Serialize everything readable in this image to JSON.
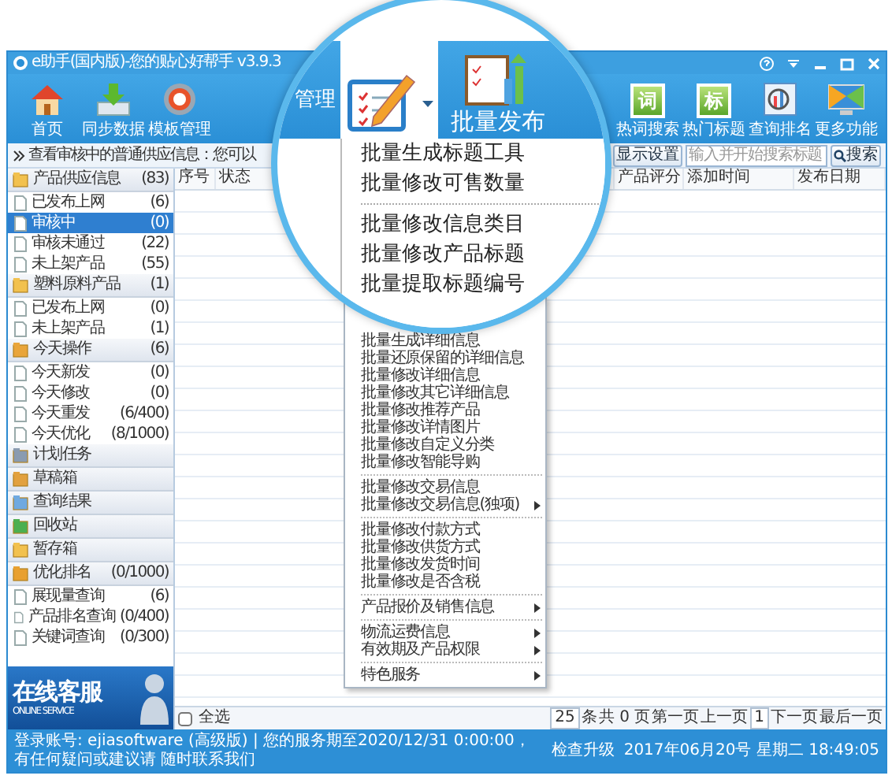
{
  "window": {
    "title": "e助手(国内版)-您的贴心好帮手 v3.9.3"
  },
  "toolbar": {
    "left": [
      {
        "kind": "home",
        "label": "首页"
      },
      {
        "kind": "sync",
        "label": "同步数据"
      },
      {
        "kind": "template",
        "label": "模板管理"
      }
    ],
    "right": [
      {
        "kind": "tile",
        "icon_text": "词",
        "label": "热词搜索"
      },
      {
        "kind": "tile",
        "icon_text": "标",
        "label": "热门标题"
      },
      {
        "kind": "rank",
        "label": "查询排名"
      },
      {
        "kind": "monitor",
        "label": "更多功能"
      }
    ]
  },
  "info_bar": {
    "text": "查看审核中的普通供应信息：您可以",
    "settings_button": "显示设置",
    "search": {
      "placeholder": "输入并开始搜索标题"
    },
    "search_button": "搜索"
  },
  "sidebar": {
    "groups": [
      {
        "kind": "folder",
        "label": "产品供应信息",
        "count": "(83)",
        "items": [
          {
            "label": "已发布上网",
            "count": "(6)",
            "selected": false
          },
          {
            "label": "审核中",
            "count": "(0)",
            "selected": true
          },
          {
            "label": "审核未通过",
            "count": "(22)",
            "selected": false
          },
          {
            "label": "未上架产品",
            "count": "(55)",
            "selected": false
          }
        ]
      },
      {
        "kind": "folder",
        "label": "塑料原料产品",
        "count": "(1)",
        "items": [
          {
            "label": "已发布上网",
            "count": "(0)",
            "selected": false
          },
          {
            "label": "未上架产品",
            "count": "(1)",
            "selected": false
          }
        ]
      },
      {
        "kind": "today",
        "label": "今天操作",
        "count": "(6)",
        "items": [
          {
            "label": "今天新发",
            "count": "(0)",
            "selected": false
          },
          {
            "label": "今天修改",
            "count": "(0)",
            "selected": false
          },
          {
            "label": "今天重发",
            "count": "(6/400)",
            "selected": false
          },
          {
            "label": "今天优化",
            "count": "(8/1000)",
            "selected": false
          }
        ]
      },
      {
        "kind": "tasks",
        "label": "计划任务"
      },
      {
        "kind": "draft",
        "label": "草稿箱"
      },
      {
        "kind": "results",
        "label": "查询结果"
      },
      {
        "kind": "recycle",
        "label": "回收站"
      },
      {
        "kind": "folder",
        "label": "暂存箱"
      },
      {
        "kind": "ranking",
        "label": "优化排名",
        "count": "(0/1000)",
        "items": [
          {
            "label": "展现量查询",
            "count": "(6)",
            "selected": false
          },
          {
            "label": "产品排名查询",
            "count": "(0/400)",
            "selected": false
          },
          {
            "label": "关键词查询",
            "count": "(0/300)",
            "selected": false
          }
        ]
      }
    ],
    "banner": {
      "title": "在线客服",
      "subtitle": "ONLINE SERVICE"
    }
  },
  "table": {
    "columns": [
      "序号",
      "状态",
      "产品评分",
      "添加时间",
      "发布日期"
    ]
  },
  "pager": {
    "select_all": "全选",
    "checked": false,
    "page_size": "25",
    "unit": "条",
    "total": "共 0 页",
    "first": "第一页",
    "prev": "上一页",
    "page": "1",
    "next": "下一页",
    "last": "最后一页"
  },
  "menu": [
    {
      "kind": "item",
      "label": "批量生成详细信息",
      "submenu": false
    },
    {
      "kind": "item",
      "label": "批量还原保留的详细信息",
      "submenu": false
    },
    {
      "kind": "item",
      "label": "批量修改详细信息",
      "submenu": false
    },
    {
      "kind": "item",
      "label": "批量修改其它详细信息",
      "submenu": false
    },
    {
      "kind": "item",
      "label": "批量修改推荐产品",
      "submenu": false
    },
    {
      "kind": "item",
      "label": "批量修改详情图片",
      "submenu": false
    },
    {
      "kind": "item",
      "label": "批量修改自定义分类",
      "submenu": false
    },
    {
      "kind": "item",
      "label": "批量修改智能导购",
      "submenu": false
    },
    {
      "kind": "separator"
    },
    {
      "kind": "item",
      "label": "批量修改交易信息",
      "submenu": false
    },
    {
      "kind": "item",
      "label": "批量修改交易信息(独项)",
      "submenu": true
    },
    {
      "kind": "separator"
    },
    {
      "kind": "item",
      "label": "批量修改付款方式",
      "submenu": false
    },
    {
      "kind": "item",
      "label": "批量修改供货方式",
      "submenu": false
    },
    {
      "kind": "item",
      "label": "批量修改发货时间",
      "submenu": false
    },
    {
      "kind": "item",
      "label": "批量修改是否含税",
      "submenu": false
    },
    {
      "kind": "separator"
    },
    {
      "kind": "item",
      "label": "产品报价及销售信息",
      "submenu": true
    },
    {
      "kind": "separator"
    },
    {
      "kind": "item",
      "label": "物流运费信息",
      "submenu": true
    },
    {
      "kind": "item",
      "label": "有效期及产品权限",
      "submenu": true
    },
    {
      "kind": "separator"
    },
    {
      "kind": "item",
      "label": "特色服务",
      "submenu": true
    }
  ],
  "magnifier": {
    "partial_label": "管理",
    "tools": [
      {
        "kind": "edit",
        "selected": true,
        "dropdown": true
      },
      {
        "kind": "publish",
        "label": "批量发布",
        "selected": false,
        "dropdown": false
      }
    ],
    "menu": [
      {
        "kind": "item",
        "label": "批量生成标题工具"
      },
      {
        "kind": "item",
        "label": "批量修改可售数量"
      },
      {
        "kind": "separator"
      },
      {
        "kind": "item",
        "label": "批量修改信息类目"
      },
      {
        "kind": "item",
        "label": "批量修改产品标题"
      },
      {
        "kind": "item",
        "label": "批量提取标题编号"
      }
    ]
  },
  "status_bar": {
    "message": "登录账号: ejiasoftware (高级版) | 您的服务期至2020/12/31 0:00:00，有任何疑问或建议请",
    "contact_link": "随时联系我们",
    "update_link": "检查升级",
    "datetime": "2017年06月20号 星期二 18:49:05"
  }
}
